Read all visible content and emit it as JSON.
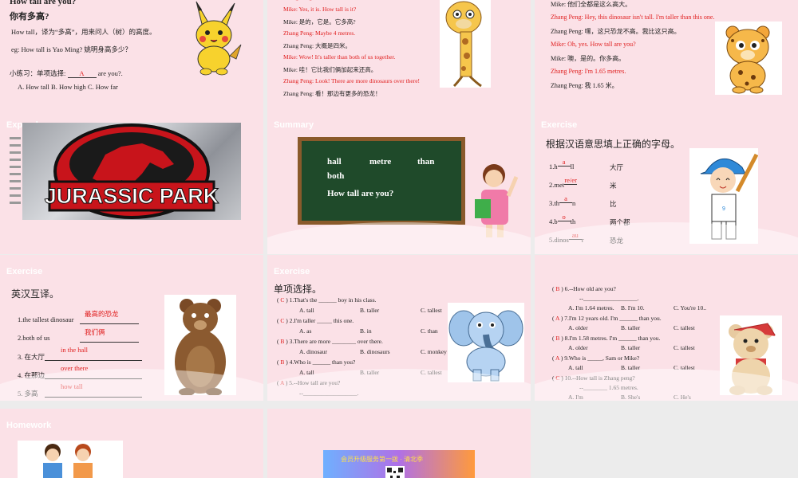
{
  "s1": {
    "title_en": "How tall are you?",
    "title_cn": "你有多高?",
    "note1": "How tall，译为“多高”，用来问人（树）的高度。",
    "eg": "eg: How tall is Yao Ming?    姚明身高多少？",
    "practice_prefix": "小练习：单项选择:",
    "practice_answer": "A",
    "practice_suffix": "are you?.",
    "options": "A. How tall     B. How high     C. How far"
  },
  "s2": {
    "lines": [
      {
        "text": "Zhang Peng: ...",
        "red": true
      },
      {
        "text": "Mike: Yes, it is. How tall is it?",
        "red": true
      },
      {
        "text": "Mike: 是的，它是。它多高?",
        "red": false
      },
      {
        "text": "Zhang Peng: Maybe 4 metres.",
        "red": true
      },
      {
        "text": "Zhang Peng: 大概是四米。",
        "red": false
      },
      {
        "text": "Mike: Wow! It's taller than both of us together.",
        "red": true
      },
      {
        "text": "Mike: 哇！它比我们俩加起来还高。",
        "red": false
      },
      {
        "text": "Zhang Peng: Look! There are more dinosaurs over there!",
        "red": true
      },
      {
        "text": "Zhang Peng: 看！那边有更多的恐龙！",
        "red": false
      }
    ]
  },
  "s3": {
    "lines": [
      {
        "text": "Mike: 他们全都是这么高大。",
        "red": false
      },
      {
        "text": "Zhang Peng: Hey, this dinosaur isn't tall. I'm taller than this one.",
        "red": true
      },
      {
        "text": "Zhang Peng: 嘿，这只恐龙不高。我比这只高。",
        "red": false
      },
      {
        "text": "Mike: Oh, yes. How tall are you?",
        "red": true
      },
      {
        "text": "Mike: 噢，是的。你多高。",
        "red": false
      },
      {
        "text": "Zhang Peng: I'm 1.65 metres.",
        "red": true
      },
      {
        "text": "Zhang Peng: 我 1.65 米。",
        "red": false
      }
    ]
  },
  "s4": {
    "header": "Expand",
    "logo_text": "JURASSIC PARK"
  },
  "s5": {
    "header": "Summary",
    "words": [
      "hall",
      "metre",
      "than",
      "both"
    ],
    "phrase": "How tall are you?"
  },
  "s6": {
    "header": "Exercise",
    "instruction": "根据汉语意思填上正确的字母。",
    "items": [
      {
        "num": "1.h",
        "ans": "a",
        "tail": "ll",
        "cn": "大厅"
      },
      {
        "num": "2.met",
        "ans": "re/er",
        "tail": "",
        "cn": "米"
      },
      {
        "num": "3.th",
        "ans": "a",
        "tail": "n",
        "cn": "比"
      },
      {
        "num": "4.b",
        "ans": "o",
        "tail": "th",
        "cn": "两个都"
      },
      {
        "num": "5.dinos",
        "ans": "au",
        "tail": "r",
        "cn": "恐龙"
      }
    ]
  },
  "s7": {
    "header": "Exercise",
    "instruction": "英汉互译。",
    "items": [
      {
        "q": "1.the tallest dinosaur",
        "a": "最高的恐龙"
      },
      {
        "q": "2.both of us",
        "a": "我们俩"
      },
      {
        "q": "3. 在大厅",
        "a": "in the hall"
      },
      {
        "q": "4. 在那边",
        "a": "over there"
      },
      {
        "q": "5. 多高",
        "a": "how tall"
      }
    ]
  },
  "s8": {
    "header": "Exercise",
    "instruction": "单项选择。",
    "items": [
      {
        "ans": "C",
        "q": "1.That's the ______ boy in his class.",
        "opts": [
          "A. tall",
          "B. taller",
          "C. tallest"
        ]
      },
      {
        "ans": "C",
        "q": "2.I'm taller _____ this one.",
        "opts": [
          "A. as",
          "B. in",
          "C. than"
        ]
      },
      {
        "ans": "B",
        "q": "3.There are more ________ over there.",
        "opts": [
          "A. dinosaur",
          "B. dinosaurs",
          "C. monkey"
        ]
      },
      {
        "ans": "B",
        "q": "4.Who is ______ than you?",
        "opts": [
          "A. tall",
          "B. taller",
          "C. tallest"
        ]
      },
      {
        "ans": "A",
        "q": "5.--How tall are you?",
        "opts": [
          "--__________________."
        ]
      },
      {
        "ans": "",
        "q": "",
        "opts": [
          "A. I'm 1.64 metres",
          "B. I'm 10.",
          "C. You're 1.64 metres"
        ]
      }
    ]
  },
  "s9": {
    "items": [
      {
        "ans": "B",
        "q": "6.--How old are you?",
        "sub": "--__________________.",
        "opts": [
          "A. I'm 1.64 metres.",
          "B. I'm 10.",
          "C. You're 10.."
        ]
      },
      {
        "ans": "A",
        "q": "7.I'm 12 years old. I'm ______ than you.",
        "sub": "",
        "opts": [
          "A. older",
          "B. taller",
          "C. tallest"
        ]
      },
      {
        "ans": "B",
        "q": "8.I'm 1.58 metres. I'm ______ than you.",
        "sub": "",
        "opts": [
          "A. older",
          "B. taller",
          "C. tallest"
        ]
      },
      {
        "ans": "A",
        "q": "9.Who is _____, Sam or Mike?",
        "sub": "",
        "opts": [
          "A. tall",
          "B. taller",
          "C. tallest"
        ]
      },
      {
        "ans": "C",
        "q": "10.--How tall is Zhang peng?",
        "sub": "--________ 1.65 metres.",
        "opts": [
          "A. I'm",
          "B. She's",
          "C. He's"
        ]
      }
    ]
  },
  "s10": {
    "header": "Homework"
  },
  "s11": {
    "banner": "会员升级服务第一拨 · 清北季"
  },
  "colors": {
    "slide_bg": "#fbe1e7",
    "answer_red": "#e02020",
    "board_green": "#1f4a2a"
  }
}
